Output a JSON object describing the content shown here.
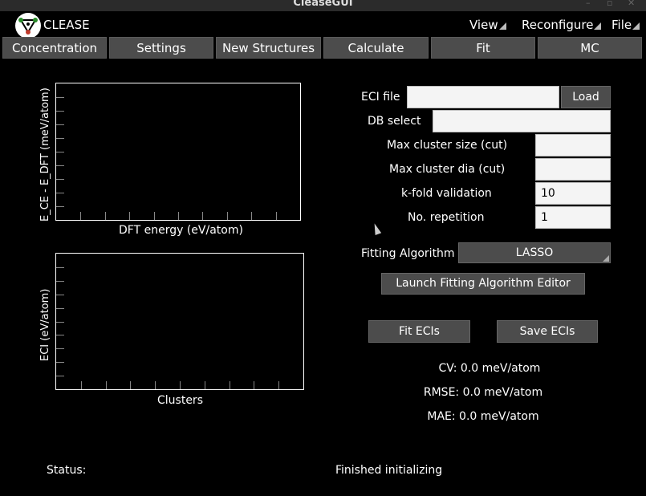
{
  "window": {
    "title": "CleaseGUI"
  },
  "app": {
    "name": "CLEASE"
  },
  "menus": [
    {
      "label": "View"
    },
    {
      "label": "Reconfigure"
    },
    {
      "label": "File"
    }
  ],
  "tabs": [
    {
      "label": "Concentration"
    },
    {
      "label": "Settings"
    },
    {
      "label": "New Structures"
    },
    {
      "label": "Calculate"
    },
    {
      "label": "Fit"
    },
    {
      "label": "MC"
    }
  ],
  "plots": {
    "top": {
      "ylabel": "E_CE - E_DFT (meV/atom)",
      "xlabel": "DFT energy (eV/atom)"
    },
    "bottom": {
      "ylabel": "ECI (eV/atom)",
      "xlabel": "Clusters"
    }
  },
  "form": {
    "eci_file": {
      "label": "ECI file",
      "value": ""
    },
    "load_label": "Load",
    "db_select": {
      "label": "DB select",
      "value": ""
    },
    "max_cluster_size": {
      "label": "Max cluster size (cut)",
      "value": ""
    },
    "max_cluster_dia": {
      "label": "Max cluster dia (cut)",
      "value": ""
    },
    "k_fold": {
      "label": "k-fold validation",
      "value": "10"
    },
    "repetition": {
      "label": "No. repetition",
      "value": "1"
    },
    "fitting_algorithm": {
      "label": "Fitting Algorithm",
      "value": "LASSO"
    },
    "launch_editor_label": "Launch Fitting Algorithm Editor",
    "fit_ecis_label": "Fit ECIs",
    "save_ecis_label": "Save ECIs"
  },
  "metrics": {
    "cv": "CV: 0.0 meV/atom",
    "rmse": "RMSE: 0.0 meV/atom",
    "mae": "MAE: 0.0 meV/atom"
  },
  "status": {
    "label": "Status:",
    "message": "Finished initializing"
  },
  "colors": {
    "background": "#000000",
    "button": "#4c4c4c",
    "field": "#f4f4f4"
  }
}
